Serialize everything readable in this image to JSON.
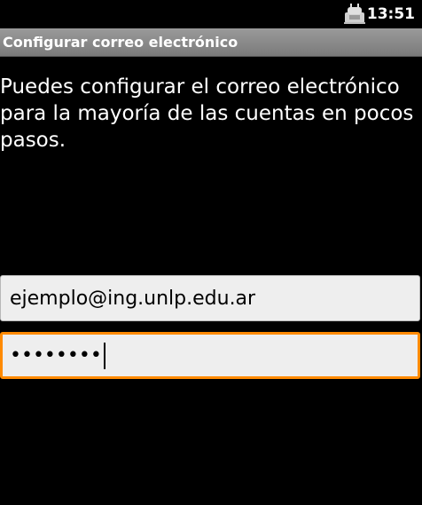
{
  "status_bar": {
    "time": "13:51",
    "icon": "android-debug-icon"
  },
  "title_bar": {
    "title": "Configurar correo electrónico"
  },
  "main": {
    "instructions": "Puedes configurar el correo electrónico para la mayoría de las cuentas en pocos pasos."
  },
  "form": {
    "email_value": "ejemplo@ing.unlp.edu.ar",
    "password_mask": "••••••••"
  },
  "colors": {
    "background": "#000000",
    "focus_border": "#ff8a00",
    "title_bar": "#8a8a8a"
  }
}
